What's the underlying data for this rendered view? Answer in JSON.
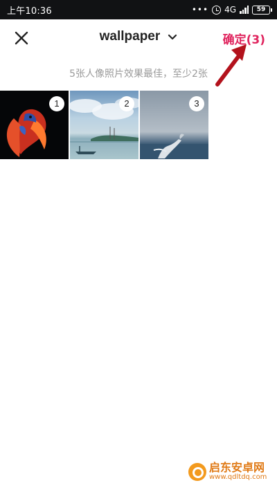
{
  "status_bar": {
    "time": "上午10:36",
    "network": "4G",
    "battery": "59",
    "dots": "•••"
  },
  "header": {
    "title": "wallpaper",
    "confirm_label": "确定(3)",
    "accent_color": "#e0245e"
  },
  "hint": "5张人像照片效果最佳，至少2张",
  "photos": [
    {
      "index": "1",
      "subject": "betta-fish"
    },
    {
      "index": "2",
      "subject": "lake-landscape"
    },
    {
      "index": "3",
      "subject": "breaching-whale"
    }
  ],
  "watermark": {
    "name": "启东安卓网",
    "url": "www.qdltdq.com"
  }
}
